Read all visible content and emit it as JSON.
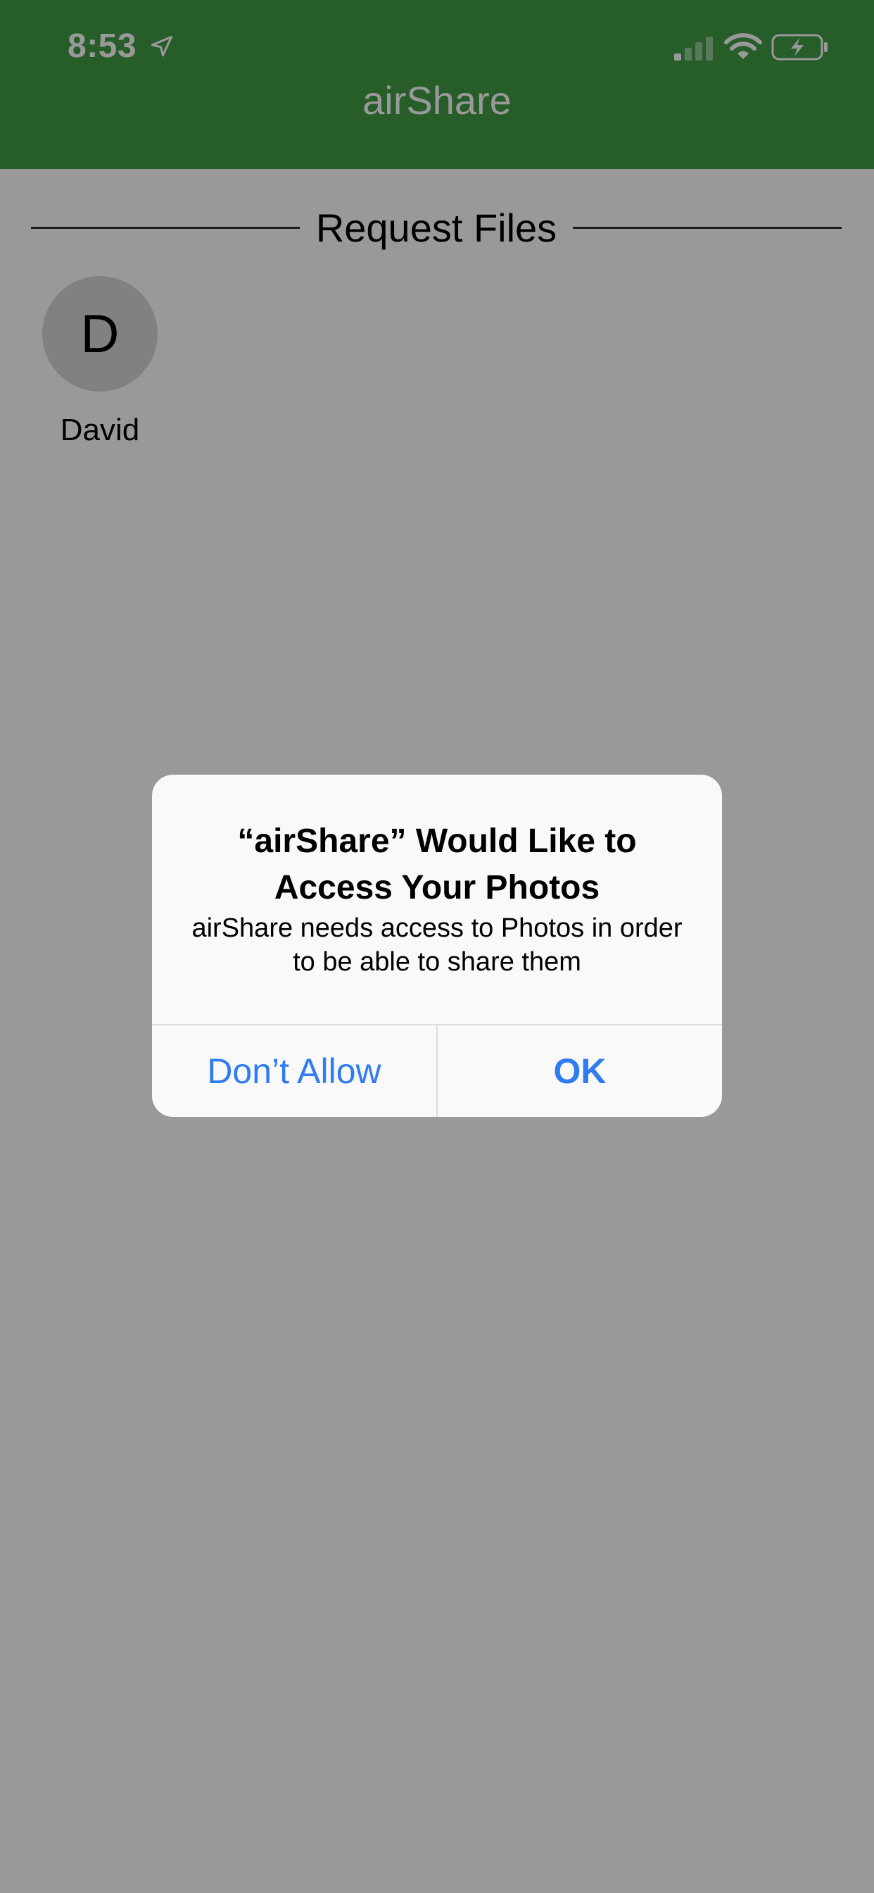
{
  "status_bar": {
    "time": "8:53",
    "icons": [
      "location-arrow-icon",
      "cellular-signal-icon",
      "wifi-icon",
      "battery-charging-icon"
    ]
  },
  "nav": {
    "title": "airShare"
  },
  "section": {
    "title": "Request Files"
  },
  "contacts": [
    {
      "initial": "D",
      "name": "David"
    }
  ],
  "alert": {
    "title": "“airShare” Would Like to Access Your Photos",
    "message": "airShare needs access to Photos in order to be able to share them",
    "buttons": {
      "deny": "Don’t Allow",
      "ok": "OK"
    }
  },
  "colors": {
    "nav_green": "#409c45",
    "ios_blue": "#2f7bf0",
    "avatar_gray": "#d7d7d7"
  }
}
